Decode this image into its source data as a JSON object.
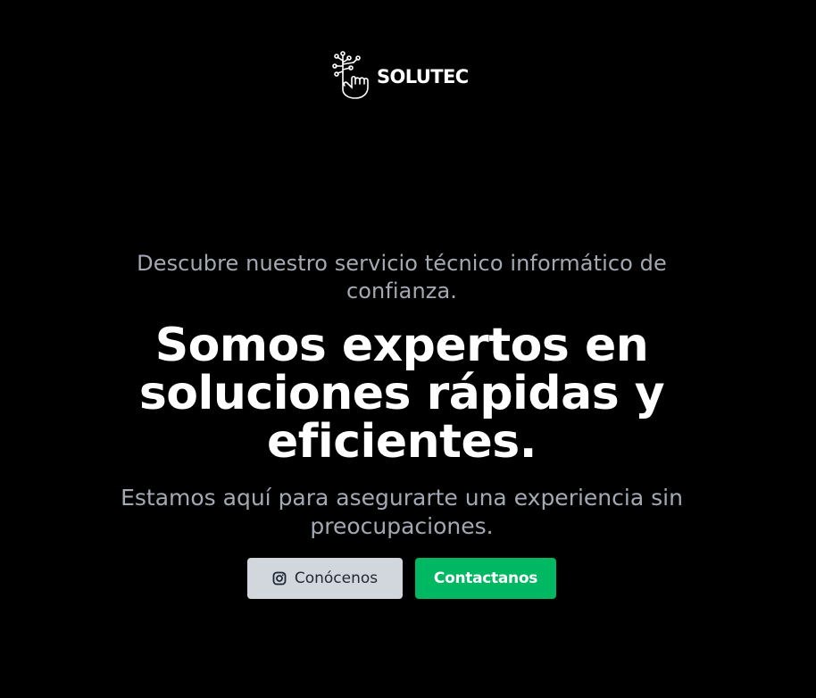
{
  "brand": {
    "name": "SOLUTEC",
    "logo_icon": "circuit-hand-icon"
  },
  "hero": {
    "tagline": "Descubre nuestro servicio técnico informático de confianza.",
    "headline": "Somos expertos en soluciones rápidas y eficientes.",
    "subline": "Estamos aquí para asegurarte una experiencia sin preocupaciones."
  },
  "actions": {
    "about_label": "Conócenos",
    "about_icon": "instagram-icon",
    "contact_label": "Contactanos"
  },
  "colors": {
    "background": "#000000",
    "muted_text": "#a3a9b3",
    "about_button": "#d2d6dd",
    "contact_button": "#00b862"
  }
}
